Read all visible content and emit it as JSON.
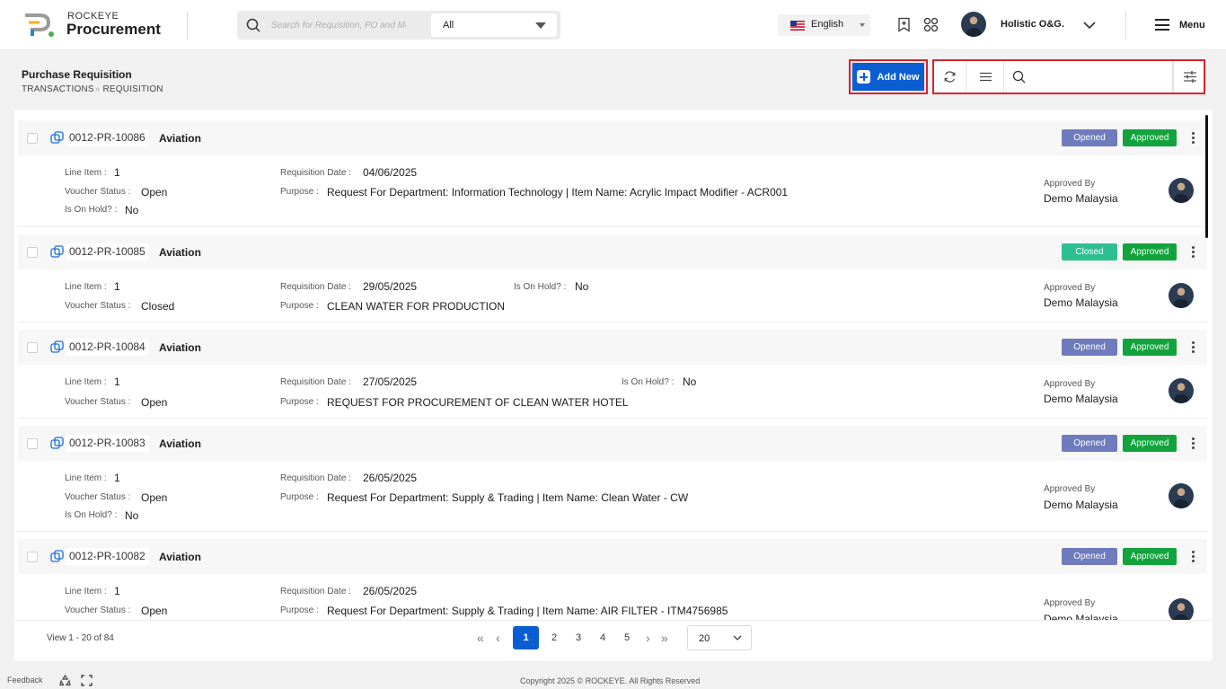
{
  "header": {
    "brand_small": "ROCKEYE",
    "brand_big": "Procurement",
    "search_placeholder": "Search for Requisition, PO and More",
    "scope_value": "All",
    "language": "English",
    "user_name": "Holistic O&G.",
    "menu_label": "Menu"
  },
  "page": {
    "title": "Purchase Requisition",
    "breadcrumb": [
      "TRANSACTIONS",
      "REQUISITION"
    ],
    "add_new_label": "Add New"
  },
  "labels": {
    "line_item": "Line Item :",
    "voucher_status": "Voucher Status :",
    "on_hold": "Is On Hold? :",
    "req_date": "Requisition Date :",
    "purpose": "Purpose :",
    "approved_by": "Approved By"
  },
  "requisitions": [
    {
      "code": "0012-PR-10086",
      "department": "Aviation",
      "status": "Opened",
      "approval": "Approved",
      "line_item": "1",
      "voucher_status": "Open",
      "on_hold": "No",
      "req_date": "04/06/2025",
      "purpose": "Request For Department: Information Technology | Item Name: Acrylic Impact Modifier - ACR001",
      "approved_by": "Demo Malaysia"
    },
    {
      "code": "0012-PR-10085",
      "department": "Aviation",
      "status": "Closed",
      "approval": "Approved",
      "line_item": "1",
      "voucher_status": "Closed",
      "on_hold": "No",
      "req_date": "29/05/2025",
      "purpose": "CLEAN WATER FOR PRODUCTION",
      "approved_by": "Demo Malaysia"
    },
    {
      "code": "0012-PR-10084",
      "department": "Aviation",
      "status": "Opened",
      "approval": "Approved",
      "line_item": "1",
      "voucher_status": "Open",
      "on_hold": "No",
      "req_date": "27/05/2025",
      "purpose": "REQUEST FOR PROCUREMENT OF CLEAN WATER HOTEL",
      "approved_by": "Demo Malaysia"
    },
    {
      "code": "0012-PR-10083",
      "department": "Aviation",
      "status": "Opened",
      "approval": "Approved",
      "line_item": "1",
      "voucher_status": "Open",
      "on_hold": "No",
      "req_date": "26/05/2025",
      "purpose": "Request For Department: Supply & Trading | Item Name: Clean Water - CW",
      "approved_by": "Demo Malaysia"
    },
    {
      "code": "0012-PR-10082",
      "department": "Aviation",
      "status": "Opened",
      "approval": "Approved",
      "line_item": "1",
      "voucher_status": "Open",
      "on_hold": "",
      "req_date": "26/05/2025",
      "purpose": "Request For Department: Supply & Trading | Item Name: AIR FILTER - ITM4756985",
      "approved_by": "Demo Malaysia"
    }
  ],
  "pagination": {
    "view_info": "View 1 - 20 of 84",
    "pages": [
      "1",
      "2",
      "3",
      "4",
      "5"
    ],
    "current_page": "1",
    "page_size": "20"
  },
  "footer": {
    "feedback": "Feedback",
    "copyright": "Copyright 2025 © ROCKEYE. All Rights Reserved"
  },
  "colors": {
    "primary": "#0b5ed1",
    "opened_badge": "#6e7bbd",
    "closed_badge": "#2ebf91",
    "approved_badge": "#13a33d",
    "highlight_border": "#e0202a"
  }
}
